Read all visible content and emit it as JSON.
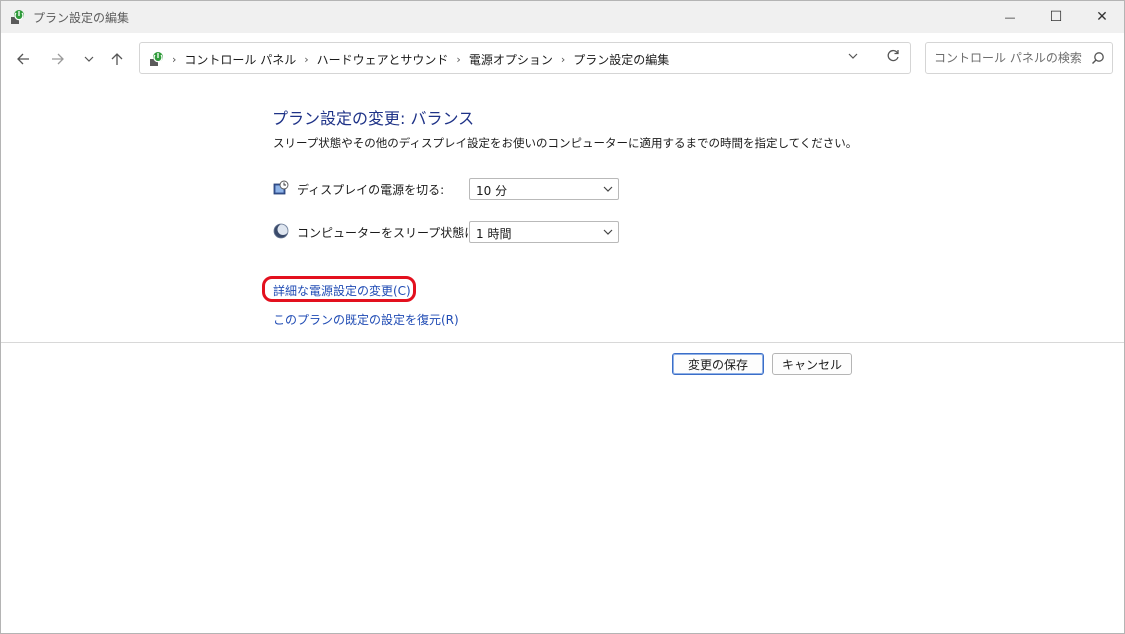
{
  "window": {
    "title": "プラン設定の編集",
    "controls": {
      "minimize": "—",
      "maximize": "☐",
      "close": "✕"
    }
  },
  "nav": {
    "back_icon": "arrow-left-icon",
    "forward_icon": "arrow-right-icon",
    "recent_icon": "chevron-down-icon",
    "up_icon": "arrow-up-icon"
  },
  "address": {
    "breadcrumbs": [
      "コントロール パネル",
      "ハードウェアとサウンド",
      "電源オプション",
      "プラン設定の編集"
    ]
  },
  "search": {
    "placeholder": "コントロール パネルの検索"
  },
  "main": {
    "heading": "プラン設定の変更: バランス",
    "description": "スリープ状態やその他のディスプレイ設定をお使いのコンピューターに適用するまでの時間を指定してください。",
    "settings": [
      {
        "label": "ディスプレイの電源を切る:",
        "value": "10 分",
        "icon": "display-clock-icon"
      },
      {
        "label": "コンピューターをスリープ状態にする:",
        "value": "1 時間",
        "icon": "moon-sleep-icon"
      }
    ],
    "links": {
      "advanced": "詳細な電源設定の変更(C)",
      "restore": "このプランの既定の設定を復元(R)"
    },
    "buttons": {
      "save": "変更の保存",
      "cancel": "キャンセル"
    }
  },
  "colors": {
    "heading": "#1e3287",
    "link": "#1f4bb4",
    "highlight": "#e3101e"
  }
}
